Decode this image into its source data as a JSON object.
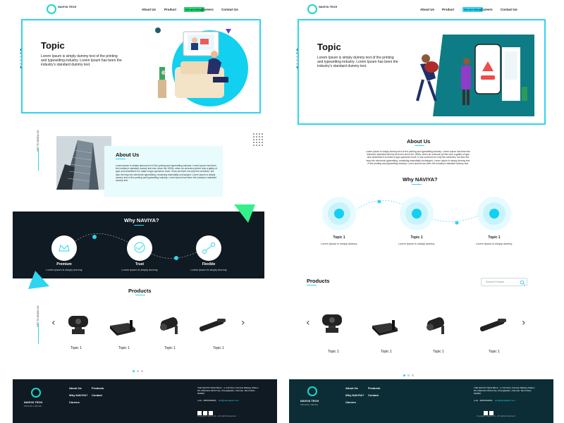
{
  "nav": {
    "brand": "NAVIYA TECH",
    "brand_sub": "PRIVATE LIMITED",
    "about": "About Us",
    "product": "Product",
    "hiring": "We are hiring!",
    "careers": "Careers",
    "contact": "Contact Us"
  },
  "hero": {
    "title": "Topic",
    "text": "Lorem Ipsum is simply dummy text of the printing and typesetting industry. Lorem Ipsum has been the industry's standard dummy text."
  },
  "side_label": "GET TO KNOW US",
  "about": {
    "title": "About Us",
    "text": "Lorem Ipsum is simply dummy text of the printing and typesetting industry. Lorem Ipsum has been the industry's standard dummy text ever since the 1500s, when an unknown printer took a galley of type and scrambled it to make a type specimen book. It has survived not only five centuries, but also the leap into electronic typesetting, remaining essentially unchanged. Lorem Ipsum is simply dummy text of the printing and typesetting industry. Lorem Ipsum has been the industry's standard dummy text."
  },
  "why": {
    "title": "Why NAVIYA?",
    "items_a": [
      {
        "label": "Premium",
        "text": "Lorem Ipsum is simply dummy"
      },
      {
        "label": "Trust",
        "text": "Lorem Ipsum is simply dummy"
      },
      {
        "label": "Flexible",
        "text": "Lorem Ipsum is simply dummy"
      }
    ],
    "items_b": [
      {
        "label": "Topic 1",
        "text": "Lorem Ipsum is simply dummy."
      },
      {
        "label": "Topic 1",
        "text": "Lorem Ipsum is simply dummy."
      },
      {
        "label": "Topic 1",
        "text": "Lorem Ipsum is simply dummy."
      }
    ]
  },
  "products": {
    "title": "Products",
    "search_placeholder": "Search Product",
    "a": [
      {
        "label": "Topic 1"
      },
      {
        "label": "Topic 1"
      },
      {
        "label": "Topic 1"
      },
      {
        "label": "Topic 1"
      }
    ],
    "b": [
      {
        "label": "Topic 1"
      },
      {
        "label": "Topic 1"
      },
      {
        "label": "Topic 1"
      },
      {
        "label": "Topic 1"
      }
    ]
  },
  "footer": {
    "links_col1": [
      "About Us",
      "Why NAVIYA?",
      "Careers"
    ],
    "links_col2": [
      "Products",
      "Contact"
    ],
    "address": "THE NAVIYA TECH Block - 4, 2nd Floor, Panorai Railway Station Rd, Mahindra World City, Chengalpattu, Chennai, Tamil Nadu 603002",
    "phone": "(+91 - 9087960696)",
    "email": "info@naviyatech.com",
    "copyright": "Copyright naviya Inc - All rights Reserved"
  },
  "colors": {
    "accent": "#2fd4f0",
    "green": "#22d36f",
    "dark": "#0f1a22",
    "footer_b": "#0c2d35"
  }
}
